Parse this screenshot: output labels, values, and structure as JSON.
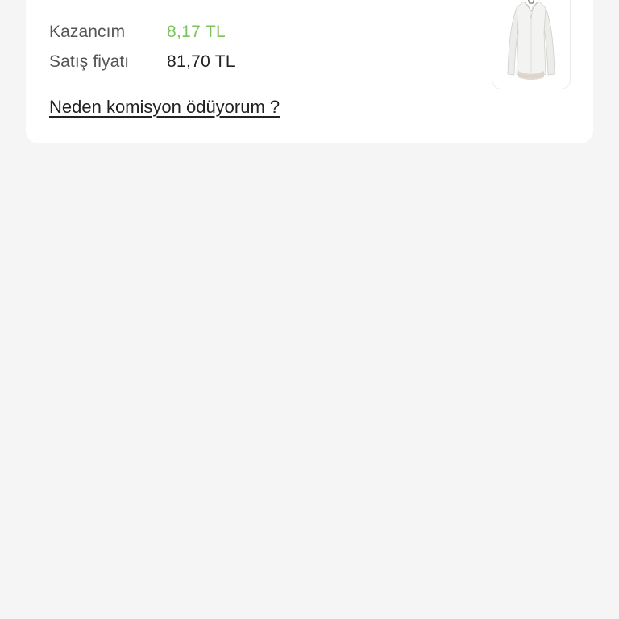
{
  "summary": {
    "earnings_label": "Kazancım",
    "earnings_value": "8,17 TL",
    "price_label": "Satış fiyatı",
    "price_value": "81,70 TL",
    "commission_link": "Neden komisyon ödüyorum ?"
  },
  "colors": {
    "earnings_value": "#7cc35b",
    "background": "#f5f5f5",
    "card": "#ffffff"
  },
  "product": {
    "image": "white-blouse-icon"
  }
}
